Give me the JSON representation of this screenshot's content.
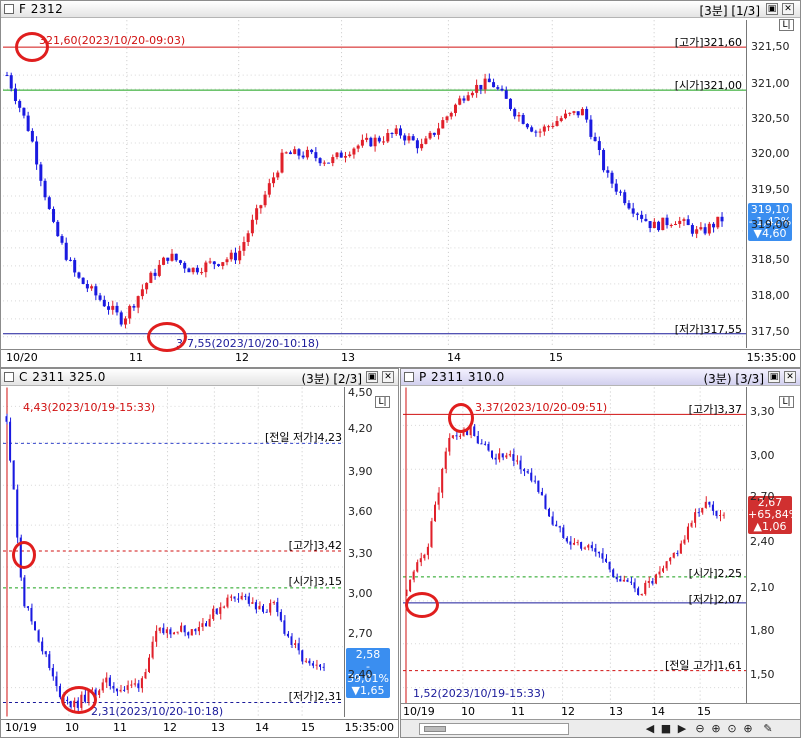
{
  "panels": {
    "f": {
      "title": "F 2312",
      "info": "[3분] [1/3]",
      "yticks": [
        "321,50",
        "321,00",
        "320,50",
        "320,00",
        "319,50",
        "319,00",
        "318,50",
        "318,00",
        "317,50"
      ],
      "xticks": [
        "10/20",
        "11",
        "12",
        "13",
        "14",
        "15",
        "15:35:00"
      ],
      "hi_annot": "321,60(2023/10/20-09:03)",
      "lo_annot": "7,55(2023/10/20-10:18)",
      "lo_prefix": "3",
      "right_labels": {
        "high": "[고가]321,60",
        "open": "[시가]321,00",
        "low": "[저가]317,55"
      },
      "badge": [
        "319,10",
        "- 1,42%",
        "▼4,60"
      ],
      "scale": "L|"
    },
    "c": {
      "title": "C 2311 325.0",
      "info": "(3분) [2/3]",
      "yticks": [
        "4,50",
        "4,20",
        "3,90",
        "3,60",
        "3,30",
        "3,00",
        "2,70",
        "2,40"
      ],
      "xticks": [
        "10/19",
        "10",
        "11",
        "12",
        "13",
        "14",
        "15",
        "15:35:00"
      ],
      "hi_annot": "4,43(2023/10/19-15:33)",
      "lo_annot": "2,31(2023/10/20-10:18)",
      "right_labels": {
        "prev_low": "[전일 저가]4,23",
        "high": "[고가]3,42",
        "open": "[시가]3,15",
        "low": "[저가]2,31"
      },
      "badge": [
        "2,58",
        "- 39,01%",
        "▼1,65"
      ],
      "scale": "L|"
    },
    "p": {
      "title": "P 2311 310.0",
      "info": "(3분) [3/3]",
      "yticks": [
        "3,30",
        "3,00",
        "2,70",
        "2,40",
        "2,10",
        "1,80",
        "1,50"
      ],
      "xticks": [
        "10/19",
        "10",
        "11",
        "12",
        "13",
        "14",
        "15"
      ],
      "hi_annot": "3,37(2023/10/20-09:51)",
      "lo_annot": "1,52(2023/10/19-15:33)",
      "right_labels": {
        "high": "[고가]3,37",
        "open": "[시가]2,25",
        "low": "[저가]2,07",
        "prev_high": "[전일 고가]1,61"
      },
      "badge": [
        "2,67",
        "+65,84%",
        "▲1,06"
      ],
      "scale": "L|"
    }
  },
  "colors": {
    "up": "#e0202a",
    "down": "#1a1ae0",
    "high_line": "#d01010",
    "open_line": "#18a018",
    "low_line": "#1a1a9a",
    "badge_down": "#3a8ef0",
    "badge_up": "#d03030"
  },
  "chart_data": [
    {
      "type": "candlestick",
      "title": "F 2312",
      "ylim": [
        317.4,
        321.75
      ],
      "x": [
        "10/20",
        "11",
        "12",
        "13",
        "14",
        "15"
      ],
      "close": [
        321.1,
        320.3,
        319.0,
        318.3,
        318.0,
        317.7,
        318.2,
        318.6,
        318.4,
        318.5,
        318.6,
        319.3,
        320.0,
        320.0,
        319.9,
        320.1,
        320.2,
        320.3,
        320.1,
        320.5,
        320.9,
        321.0,
        320.6,
        320.3,
        320.5,
        320.6,
        319.7,
        319.3,
        319.0,
        319.1,
        318.9,
        319.1
      ]
    },
    {
      "type": "candlestick",
      "title": "C 2311 325.0",
      "ylim": [
        2.3,
        4.58
      ],
      "x": [
        "10/19",
        "10",
        "11",
        "12",
        "13",
        "14",
        "15"
      ],
      "close": [
        4.43,
        3.1,
        2.8,
        2.45,
        2.33,
        2.42,
        2.5,
        2.45,
        2.5,
        2.85,
        2.9,
        2.88,
        2.95,
        3.08,
        3.15,
        3.02,
        3.05,
        2.8,
        2.62,
        2.58
      ]
    },
    {
      "type": "candlestick",
      "title": "P 2311 310.0",
      "ylim": [
        1.46,
        3.42
      ],
      "x": [
        "10/19",
        "10",
        "11",
        "12",
        "13",
        "14",
        "15"
      ],
      "close": [
        2.2,
        2.5,
        3.15,
        3.2,
        3.05,
        3.02,
        2.9,
        2.6,
        2.5,
        2.45,
        2.28,
        2.2,
        2.3,
        2.5,
        2.75,
        2.67
      ]
    }
  ]
}
